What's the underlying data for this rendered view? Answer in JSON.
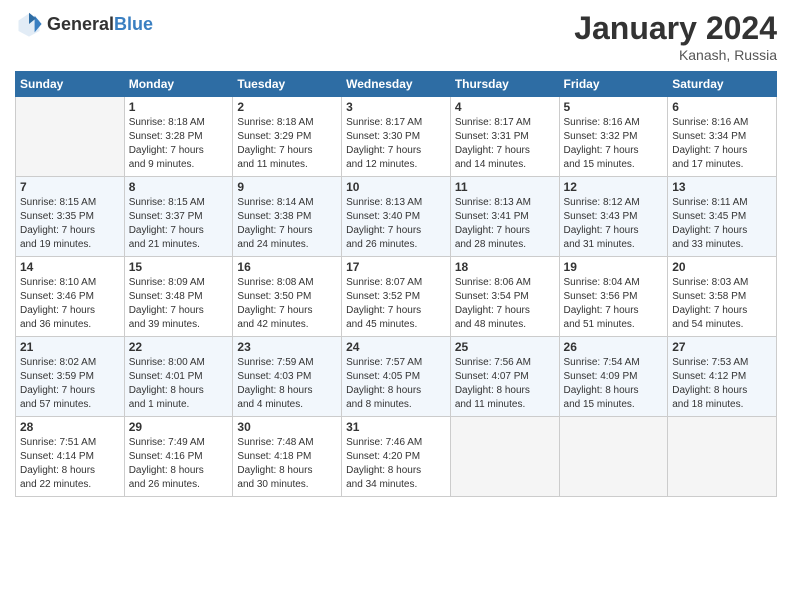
{
  "header": {
    "logo_general": "General",
    "logo_blue": "Blue",
    "title": "January 2024",
    "location": "Kanash, Russia"
  },
  "days_of_week": [
    "Sunday",
    "Monday",
    "Tuesday",
    "Wednesday",
    "Thursday",
    "Friday",
    "Saturday"
  ],
  "weeks": [
    [
      {
        "day": "",
        "info": ""
      },
      {
        "day": "1",
        "info": "Sunrise: 8:18 AM\nSunset: 3:28 PM\nDaylight: 7 hours\nand 9 minutes."
      },
      {
        "day": "2",
        "info": "Sunrise: 8:18 AM\nSunset: 3:29 PM\nDaylight: 7 hours\nand 11 minutes."
      },
      {
        "day": "3",
        "info": "Sunrise: 8:17 AM\nSunset: 3:30 PM\nDaylight: 7 hours\nand 12 minutes."
      },
      {
        "day": "4",
        "info": "Sunrise: 8:17 AM\nSunset: 3:31 PM\nDaylight: 7 hours\nand 14 minutes."
      },
      {
        "day": "5",
        "info": "Sunrise: 8:16 AM\nSunset: 3:32 PM\nDaylight: 7 hours\nand 15 minutes."
      },
      {
        "day": "6",
        "info": "Sunrise: 8:16 AM\nSunset: 3:34 PM\nDaylight: 7 hours\nand 17 minutes."
      }
    ],
    [
      {
        "day": "7",
        "info": "Sunrise: 8:15 AM\nSunset: 3:35 PM\nDaylight: 7 hours\nand 19 minutes."
      },
      {
        "day": "8",
        "info": "Sunrise: 8:15 AM\nSunset: 3:37 PM\nDaylight: 7 hours\nand 21 minutes."
      },
      {
        "day": "9",
        "info": "Sunrise: 8:14 AM\nSunset: 3:38 PM\nDaylight: 7 hours\nand 24 minutes."
      },
      {
        "day": "10",
        "info": "Sunrise: 8:13 AM\nSunset: 3:40 PM\nDaylight: 7 hours\nand 26 minutes."
      },
      {
        "day": "11",
        "info": "Sunrise: 8:13 AM\nSunset: 3:41 PM\nDaylight: 7 hours\nand 28 minutes."
      },
      {
        "day": "12",
        "info": "Sunrise: 8:12 AM\nSunset: 3:43 PM\nDaylight: 7 hours\nand 31 minutes."
      },
      {
        "day": "13",
        "info": "Sunrise: 8:11 AM\nSunset: 3:45 PM\nDaylight: 7 hours\nand 33 minutes."
      }
    ],
    [
      {
        "day": "14",
        "info": "Sunrise: 8:10 AM\nSunset: 3:46 PM\nDaylight: 7 hours\nand 36 minutes."
      },
      {
        "day": "15",
        "info": "Sunrise: 8:09 AM\nSunset: 3:48 PM\nDaylight: 7 hours\nand 39 minutes."
      },
      {
        "day": "16",
        "info": "Sunrise: 8:08 AM\nSunset: 3:50 PM\nDaylight: 7 hours\nand 42 minutes."
      },
      {
        "day": "17",
        "info": "Sunrise: 8:07 AM\nSunset: 3:52 PM\nDaylight: 7 hours\nand 45 minutes."
      },
      {
        "day": "18",
        "info": "Sunrise: 8:06 AM\nSunset: 3:54 PM\nDaylight: 7 hours\nand 48 minutes."
      },
      {
        "day": "19",
        "info": "Sunrise: 8:04 AM\nSunset: 3:56 PM\nDaylight: 7 hours\nand 51 minutes."
      },
      {
        "day": "20",
        "info": "Sunrise: 8:03 AM\nSunset: 3:58 PM\nDaylight: 7 hours\nand 54 minutes."
      }
    ],
    [
      {
        "day": "21",
        "info": "Sunrise: 8:02 AM\nSunset: 3:59 PM\nDaylight: 7 hours\nand 57 minutes."
      },
      {
        "day": "22",
        "info": "Sunrise: 8:00 AM\nSunset: 4:01 PM\nDaylight: 8 hours\nand 1 minute."
      },
      {
        "day": "23",
        "info": "Sunrise: 7:59 AM\nSunset: 4:03 PM\nDaylight: 8 hours\nand 4 minutes."
      },
      {
        "day": "24",
        "info": "Sunrise: 7:57 AM\nSunset: 4:05 PM\nDaylight: 8 hours\nand 8 minutes."
      },
      {
        "day": "25",
        "info": "Sunrise: 7:56 AM\nSunset: 4:07 PM\nDaylight: 8 hours\nand 11 minutes."
      },
      {
        "day": "26",
        "info": "Sunrise: 7:54 AM\nSunset: 4:09 PM\nDaylight: 8 hours\nand 15 minutes."
      },
      {
        "day": "27",
        "info": "Sunrise: 7:53 AM\nSunset: 4:12 PM\nDaylight: 8 hours\nand 18 minutes."
      }
    ],
    [
      {
        "day": "28",
        "info": "Sunrise: 7:51 AM\nSunset: 4:14 PM\nDaylight: 8 hours\nand 22 minutes."
      },
      {
        "day": "29",
        "info": "Sunrise: 7:49 AM\nSunset: 4:16 PM\nDaylight: 8 hours\nand 26 minutes."
      },
      {
        "day": "30",
        "info": "Sunrise: 7:48 AM\nSunset: 4:18 PM\nDaylight: 8 hours\nand 30 minutes."
      },
      {
        "day": "31",
        "info": "Sunrise: 7:46 AM\nSunset: 4:20 PM\nDaylight: 8 hours\nand 34 minutes."
      },
      {
        "day": "",
        "info": ""
      },
      {
        "day": "",
        "info": ""
      },
      {
        "day": "",
        "info": ""
      }
    ]
  ]
}
